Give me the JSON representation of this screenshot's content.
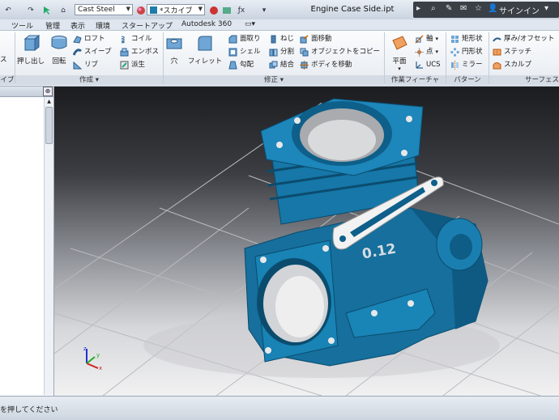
{
  "titlebar": {
    "material": "Cast Steel",
    "appearance": "*スカイブ",
    "document_title": "Engine Case Side.ipt",
    "sign_in": "サインイン"
  },
  "menu": {
    "tabs": [
      "ツール",
      "管理",
      "表示",
      "環境",
      "スタートアップ",
      "Autodesk 360"
    ]
  },
  "ribbon": {
    "create": {
      "extrude": "押し出し",
      "revolve": "回転",
      "loft": "ロフト",
      "sweep": "スイープ",
      "rib": "リブ",
      "coil": "コイル",
      "emboss": "エンボス",
      "derive": "派生",
      "label": "作成"
    },
    "modify": {
      "hole": "穴",
      "fillet": "フィレット",
      "chamfer": "面取り",
      "shell": "シェル",
      "draft": "勾配",
      "thread": "ねじ",
      "split": "分割",
      "combine": "結合",
      "move_face": "面移動",
      "copy_object": "オブジェクトをコピー",
      "move_bodies": "ボディを移動",
      "label": "修正"
    },
    "work_features": {
      "plane": "平面",
      "axis": "軸",
      "point": "点",
      "ucs": "UCS",
      "label": "作業フィーチャ"
    },
    "pattern": {
      "rectangular": "矩形状",
      "circular": "円形状",
      "mirror": "ミラー",
      "label": "パターン"
    },
    "surface": {
      "thicken": "厚み/オフセット",
      "stitch": "ステッチ",
      "sculpt": "スカルプ",
      "label": "サーフェス"
    },
    "left_partial": {
      "label1": "ス",
      "label2": "イブ"
    }
  },
  "viewport": {
    "part_marking": "0.12"
  },
  "status": {
    "text": "を押してください"
  },
  "colors": {
    "part": "#1577a6",
    "ribbon_bg": "#f3f6f9",
    "title_bg": "#d6dee8"
  }
}
